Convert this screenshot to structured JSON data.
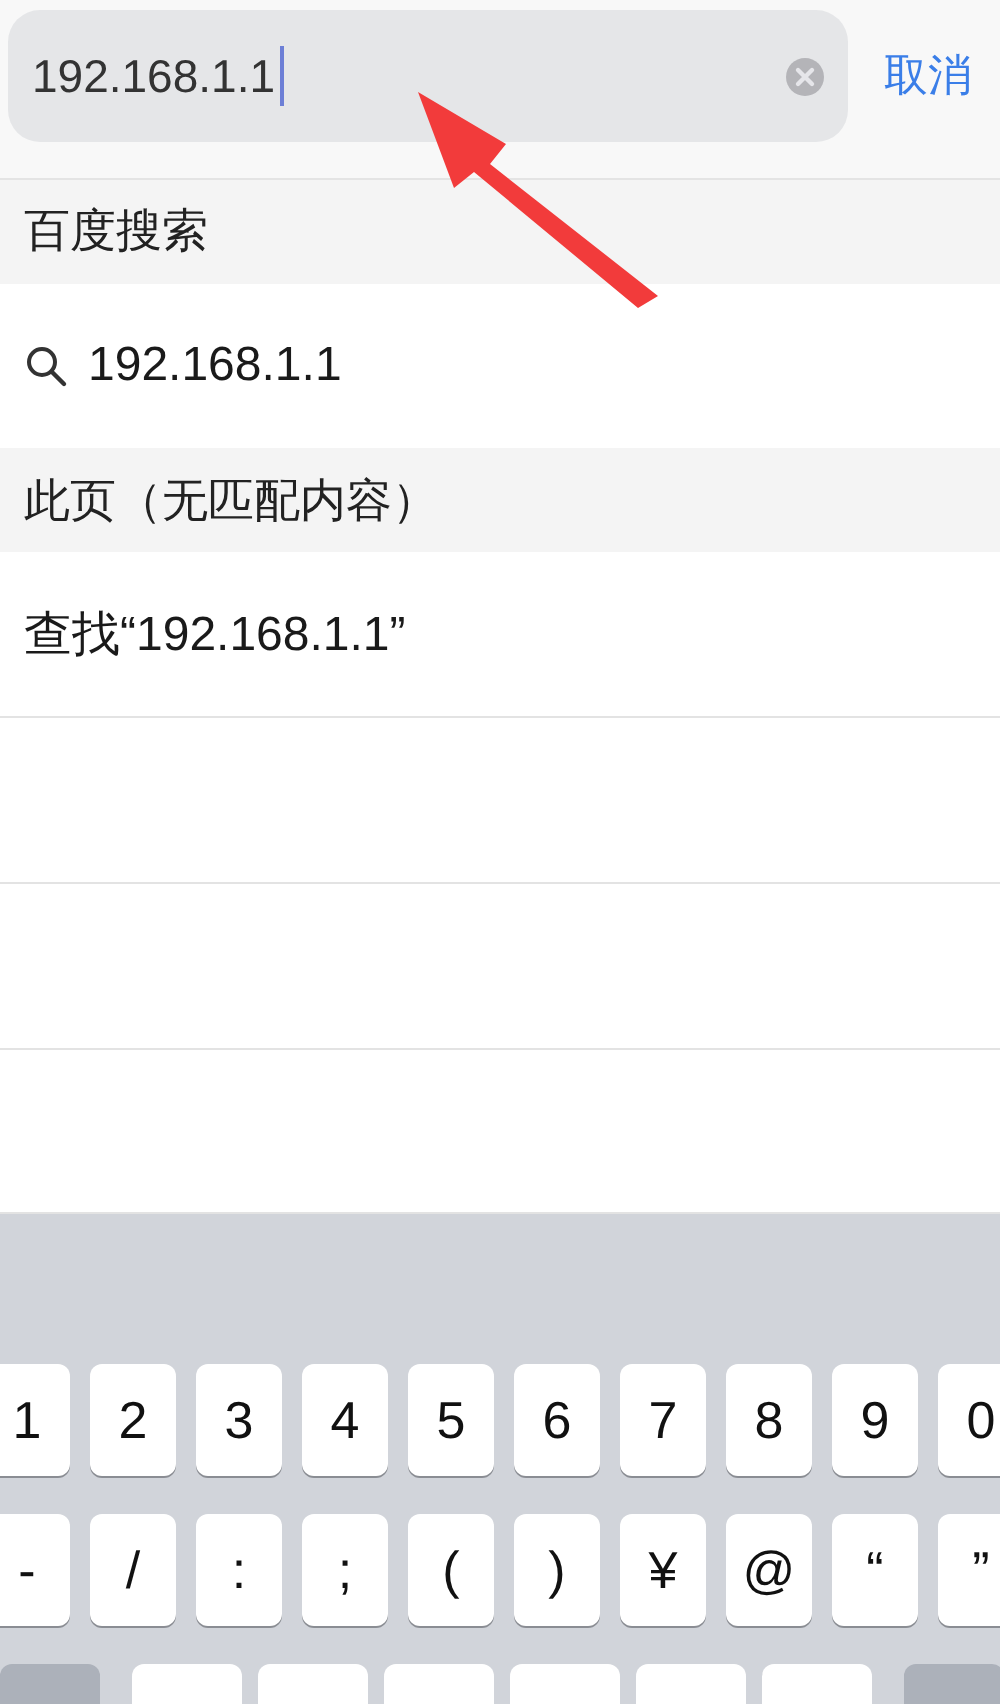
{
  "search_bar": {
    "value": "192.168.1.1",
    "focused": true,
    "cancel": "取消"
  },
  "sections": [
    {
      "header": "百度搜索",
      "rows": [
        {
          "kind": "search",
          "text": "192.168.1.1"
        }
      ]
    },
    {
      "header": "此页（无匹配内容）",
      "rows": [
        {
          "kind": "find",
          "text": "查找“192.168.1.1”"
        },
        {
          "kind": "empty"
        },
        {
          "kind": "empty"
        },
        {
          "kind": "empty"
        }
      ]
    }
  ],
  "keyboard": {
    "rows": [
      [
        {
          "kind": "char",
          "label": "1"
        },
        {
          "kind": "char",
          "label": "2"
        },
        {
          "kind": "char",
          "label": "3"
        },
        {
          "kind": "char",
          "label": "4"
        },
        {
          "kind": "char",
          "label": "5"
        },
        {
          "kind": "char",
          "label": "6"
        },
        {
          "kind": "char",
          "label": "7"
        },
        {
          "kind": "char",
          "label": "8"
        },
        {
          "kind": "char",
          "label": "9"
        },
        {
          "kind": "char",
          "label": "0"
        }
      ],
      [
        {
          "kind": "char",
          "label": "-"
        },
        {
          "kind": "char",
          "label": "/"
        },
        {
          "kind": "char",
          "label": ":"
        },
        {
          "kind": "char",
          "label": ";"
        },
        {
          "kind": "char",
          "label": "("
        },
        {
          "kind": "char",
          "label": ")"
        },
        {
          "kind": "char",
          "label": "¥"
        },
        {
          "kind": "char",
          "label": "@"
        },
        {
          "kind": "char",
          "label": "“"
        },
        {
          "kind": "char",
          "label": "”"
        }
      ],
      [
        {
          "kind": "function"
        },
        {
          "kind": "char"
        },
        {
          "kind": "char"
        },
        {
          "kind": "char"
        },
        {
          "kind": "char"
        },
        {
          "kind": "char"
        },
        {
          "kind": "char"
        },
        {
          "kind": "function"
        }
      ]
    ]
  }
}
